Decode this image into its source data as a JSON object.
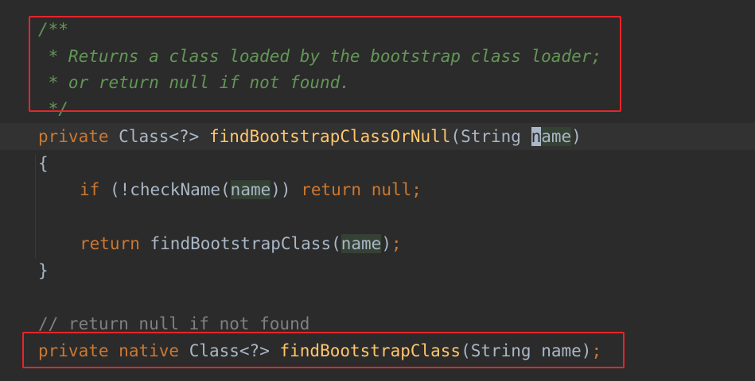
{
  "code": {
    "doc_open": "/**",
    "doc_line1": " * Returns a class loaded by the bootstrap class loader;",
    "doc_line2": " * or return null if not found.",
    "doc_close": " */",
    "sig1": {
      "kw_private": "private",
      "ret_type": "Class<?>",
      "method_name": "findBootstrapClassOrNull",
      "open_paren": "(",
      "param_type": "String",
      "param_first_char": "n",
      "param_rest": "ame",
      "close_paren": ")"
    },
    "brace_open": "{",
    "if_line": {
      "kw_if": "if",
      "cond_start": "(!checkName(",
      "param": "name",
      "cond_end": "))",
      "kw_return": "return",
      "kw_null": "null",
      "semicolon": ";"
    },
    "return_line": {
      "kw_return": "return",
      "call": "findBootstrapClass(",
      "param": "name",
      "close": ")",
      "semicolon": ";"
    },
    "brace_close": "}",
    "line_comment": "// return null if not found",
    "sig2": {
      "kw_private": "private",
      "kw_native": "native",
      "ret_type": "Class<?>",
      "method_name": "findBootstrapClass",
      "params": "(String name)",
      "semicolon": ";"
    }
  },
  "colors": {
    "background": "#2b2b2b",
    "doc_comment": "#629755",
    "keyword": "#cc7832",
    "method": "#ffc66d",
    "plain": "#a9b7c6",
    "comment": "#808080",
    "highlight_box": "#e8242a"
  }
}
